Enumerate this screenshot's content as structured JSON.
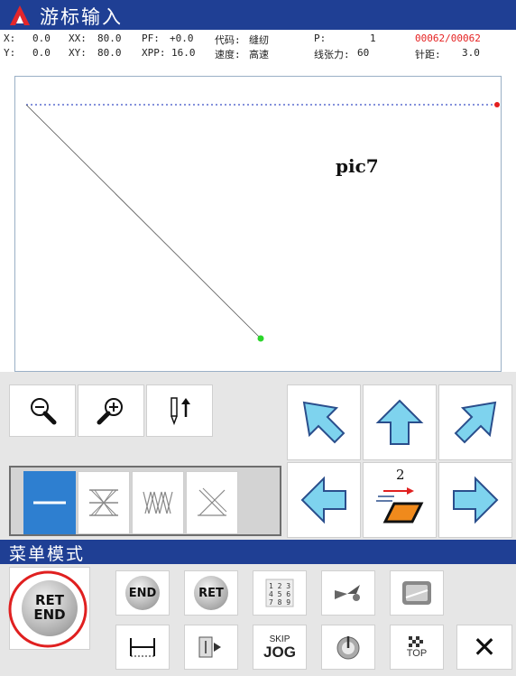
{
  "title": "游标输入",
  "status": {
    "x_label": "X:",
    "x_val": "0.0",
    "y_label": "Y:",
    "y_val": "0.0",
    "xx_label": "XX:",
    "xx_val": "80.0",
    "xy_label": "XY:",
    "xy_val": "80.0",
    "pf_label": "PF:",
    "pf_val": "+0.0",
    "xpp_label": "XPP:",
    "xpp_val": "16.0",
    "code_label": "代码:",
    "code_val": "缝纫",
    "speed_label": "速度:",
    "speed_val": "高速",
    "p_label": "P:",
    "p_val": "1",
    "tension_label": "线张力:",
    "tension_val": "60",
    "counter": "00062/00062",
    "pitch_label": "针距:",
    "pitch_val": "3.0"
  },
  "canvas": {
    "label": "pic7"
  },
  "feed_label": "2",
  "menu_title": "菜单模式",
  "buttons": {
    "ret_end_line1": "RET",
    "ret_end_line2": "END",
    "end": "END",
    "ret": "RET",
    "numpad": "1 2 3 4 5 6 7 8 9",
    "skip": "SKIP",
    "jog": "JOG",
    "top": "TOP",
    "close": "✕"
  },
  "colors": {
    "title_bg": "#1f3f94",
    "arrow_fill": "#7ed3ee",
    "highlight_blue": "#2e7fd0",
    "red_circle": "#e02020",
    "counter_red": "#e52222"
  }
}
